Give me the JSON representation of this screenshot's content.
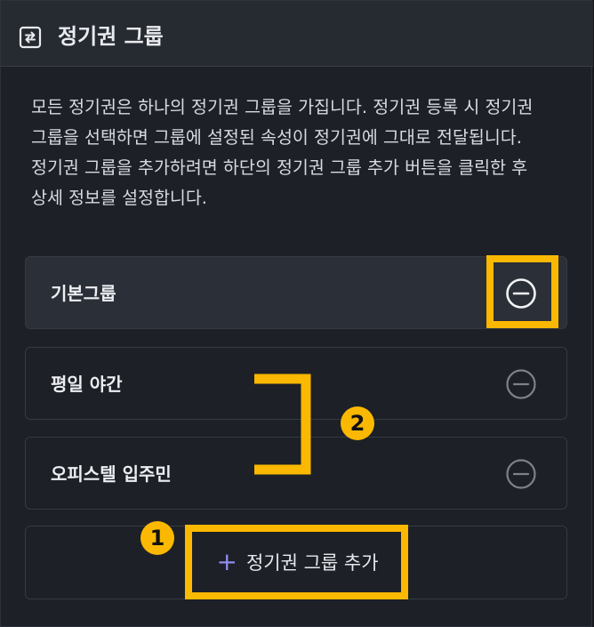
{
  "header": {
    "title": "정기권 그룹",
    "icon": "exchange-icon"
  },
  "description": "모든 정기권은 하나의 정기권 그룹을 가집니다. 정기권 등록 시 정기권 그룹을 선택하면 그룹에 설정된 속성이 정기권에 그대로 전달됩니다. 정기권 그룹을 추가하려면 하단의 정기권 그룹 추가 버튼을 클릭한 후 상세 정보를 설정합니다.",
  "groups": [
    {
      "label": "기본그룹",
      "selected": true
    },
    {
      "label": "평일 야간",
      "selected": false
    },
    {
      "label": "오피스텔 입주민",
      "selected": false
    }
  ],
  "add_button": {
    "label": "정기권 그룹 추가",
    "icon": "plus-icon"
  },
  "annotations": {
    "badge_1": "1",
    "badge_2": "2"
  },
  "colors": {
    "highlight": "#fbb800",
    "accent": "#8f8cf0"
  }
}
